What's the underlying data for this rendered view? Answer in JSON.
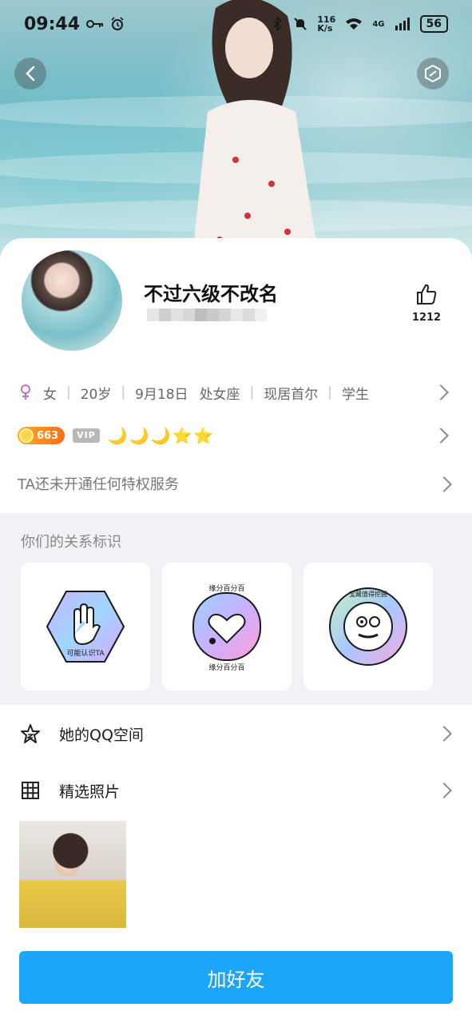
{
  "status_bar": {
    "time": "09:44",
    "net_speed_value": "116",
    "net_speed_unit": "K/s",
    "network": "4G",
    "battery": "56"
  },
  "profile": {
    "nickname": "不过六级不改名",
    "likes": "1212"
  },
  "info": {
    "gender": "女",
    "age": "20岁",
    "birthday": "9月18日",
    "zodiac": "处女座",
    "location": "现居首尔",
    "occupation": "学生"
  },
  "badges": {
    "coin_level": "663",
    "vip_label": "VIP",
    "level_icons": "🌙🌙🌙⭐⭐"
  },
  "privilege_text": "TA还未开通任何特权服务",
  "relation": {
    "title": "你们的关系标识",
    "cards": [
      {
        "text": "可能认识TA"
      },
      {
        "text": "缘分百分百"
      },
      {
        "text": "宝藏值得挖掘"
      }
    ]
  },
  "menu": {
    "qzone_label": "她的QQ空间",
    "photos_label": "精选照片"
  },
  "add_friend_label": "加好友",
  "colors": {
    "accent": "#1BA6FB",
    "coin_badge": "#FF8A1A",
    "section_bg": "#F1F2F6"
  }
}
